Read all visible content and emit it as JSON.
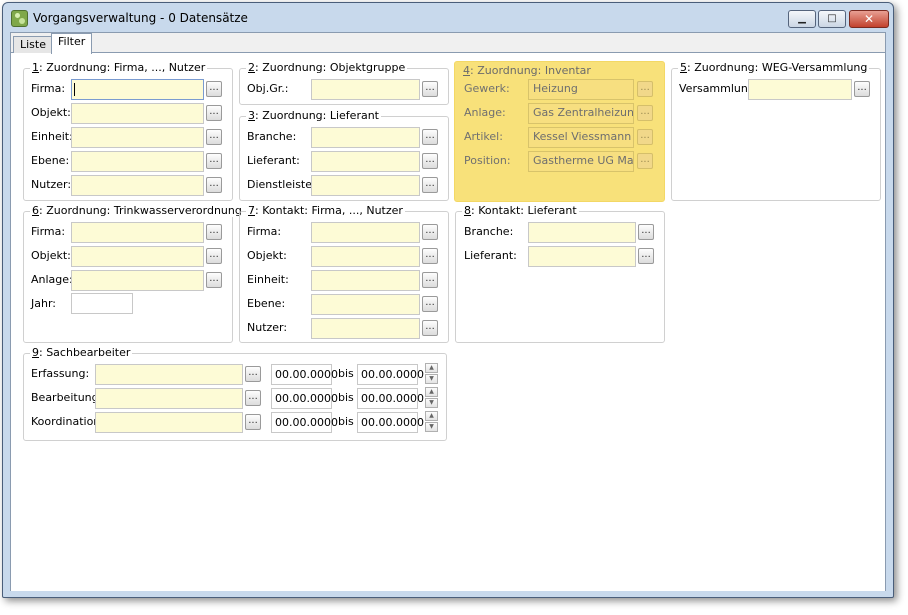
{
  "window": {
    "title": "Vorgangsverwaltung - 0 Datensätze",
    "min_glyph": "▁",
    "max_glyph": "□",
    "close_glyph": "✕",
    "app_icon": "cluster-icon"
  },
  "tabs": [
    {
      "label": "Liste",
      "active": false
    },
    {
      "label": "Filter",
      "active": true
    }
  ],
  "browse_label": "...",
  "groups": {
    "g1": {
      "num": "1",
      "rest": ": Zuordnung: Firma, ..., Nutzer",
      "fields": [
        {
          "label": "Firma:",
          "value": ""
        },
        {
          "label": "Objekt:",
          "value": ""
        },
        {
          "label": "Einheit:",
          "value": ""
        },
        {
          "label": "Ebene:",
          "value": ""
        },
        {
          "label": "Nutzer:",
          "value": ""
        }
      ]
    },
    "g2": {
      "num": "2",
      "rest": ": Zuordnung: Objektgruppe",
      "fields": [
        {
          "label": "Obj.Gr.:",
          "value": ""
        }
      ]
    },
    "g3": {
      "num": "3",
      "rest": ": Zuordnung: Lieferant",
      "fields": [
        {
          "label": "Branche:",
          "value": ""
        },
        {
          "label": "Lieferant:",
          "value": ""
        },
        {
          "label": "Dienstleister:",
          "value": ""
        }
      ]
    },
    "g4": {
      "num": "4",
      "rest": ": Zuordnung: Inventar",
      "highlight": "#f8e17a",
      "fields": [
        {
          "label": "Gewerk:",
          "value": "Heizung"
        },
        {
          "label": "Anlage:",
          "value": "Gas Zentralheizung"
        },
        {
          "label": "Artikel:",
          "value": "Kessel Viessmann FB"
        },
        {
          "label": "Position:",
          "value": "Gastherme UG Masch"
        }
      ]
    },
    "g5": {
      "num": "5",
      "rest": ": Zuordnung: WEG-Versammlung",
      "fields": [
        {
          "label": "Versammlung:",
          "value": ""
        }
      ]
    },
    "g6": {
      "num": "6",
      "rest": ": Zuordnung: Trinkwasserverordnung",
      "fields": [
        {
          "label": "Firma:",
          "value": ""
        },
        {
          "label": "Objekt:",
          "value": ""
        },
        {
          "label": "Anlage:",
          "value": ""
        },
        {
          "label": "Jahr:",
          "value": ""
        }
      ]
    },
    "g7": {
      "num": "7",
      "rest": ": Kontakt: Firma, ..., Nutzer",
      "fields": [
        {
          "label": "Firma:",
          "value": ""
        },
        {
          "label": "Objekt:",
          "value": ""
        },
        {
          "label": "Einheit:",
          "value": ""
        },
        {
          "label": "Ebene:",
          "value": ""
        },
        {
          "label": "Nutzer:",
          "value": ""
        }
      ]
    },
    "g8": {
      "num": "8",
      "rest": ": Kontakt: Lieferant",
      "fields": [
        {
          "label": "Branche:",
          "value": ""
        },
        {
          "label": "Lieferant:",
          "value": ""
        }
      ]
    },
    "g9": {
      "num": "9",
      "rest": ": Sachbearbeiter",
      "bis": "bis",
      "rows": [
        {
          "label": "Erfassung:",
          "value": "",
          "from": "00.00.0000",
          "to": "00.00.0000"
        },
        {
          "label": "Bearbeitung:",
          "value": "",
          "from": "00.00.0000",
          "to": "00.00.0000"
        },
        {
          "label": "Koordination:",
          "value": "",
          "from": "00.00.0000",
          "to": "00.00.0000"
        }
      ]
    }
  },
  "colors": {
    "field_bg": "#fdfbd6",
    "highlight": "#f8e17a",
    "frame": "#c8d9ec"
  },
  "spin_up": "▲",
  "spin_down": "▼"
}
